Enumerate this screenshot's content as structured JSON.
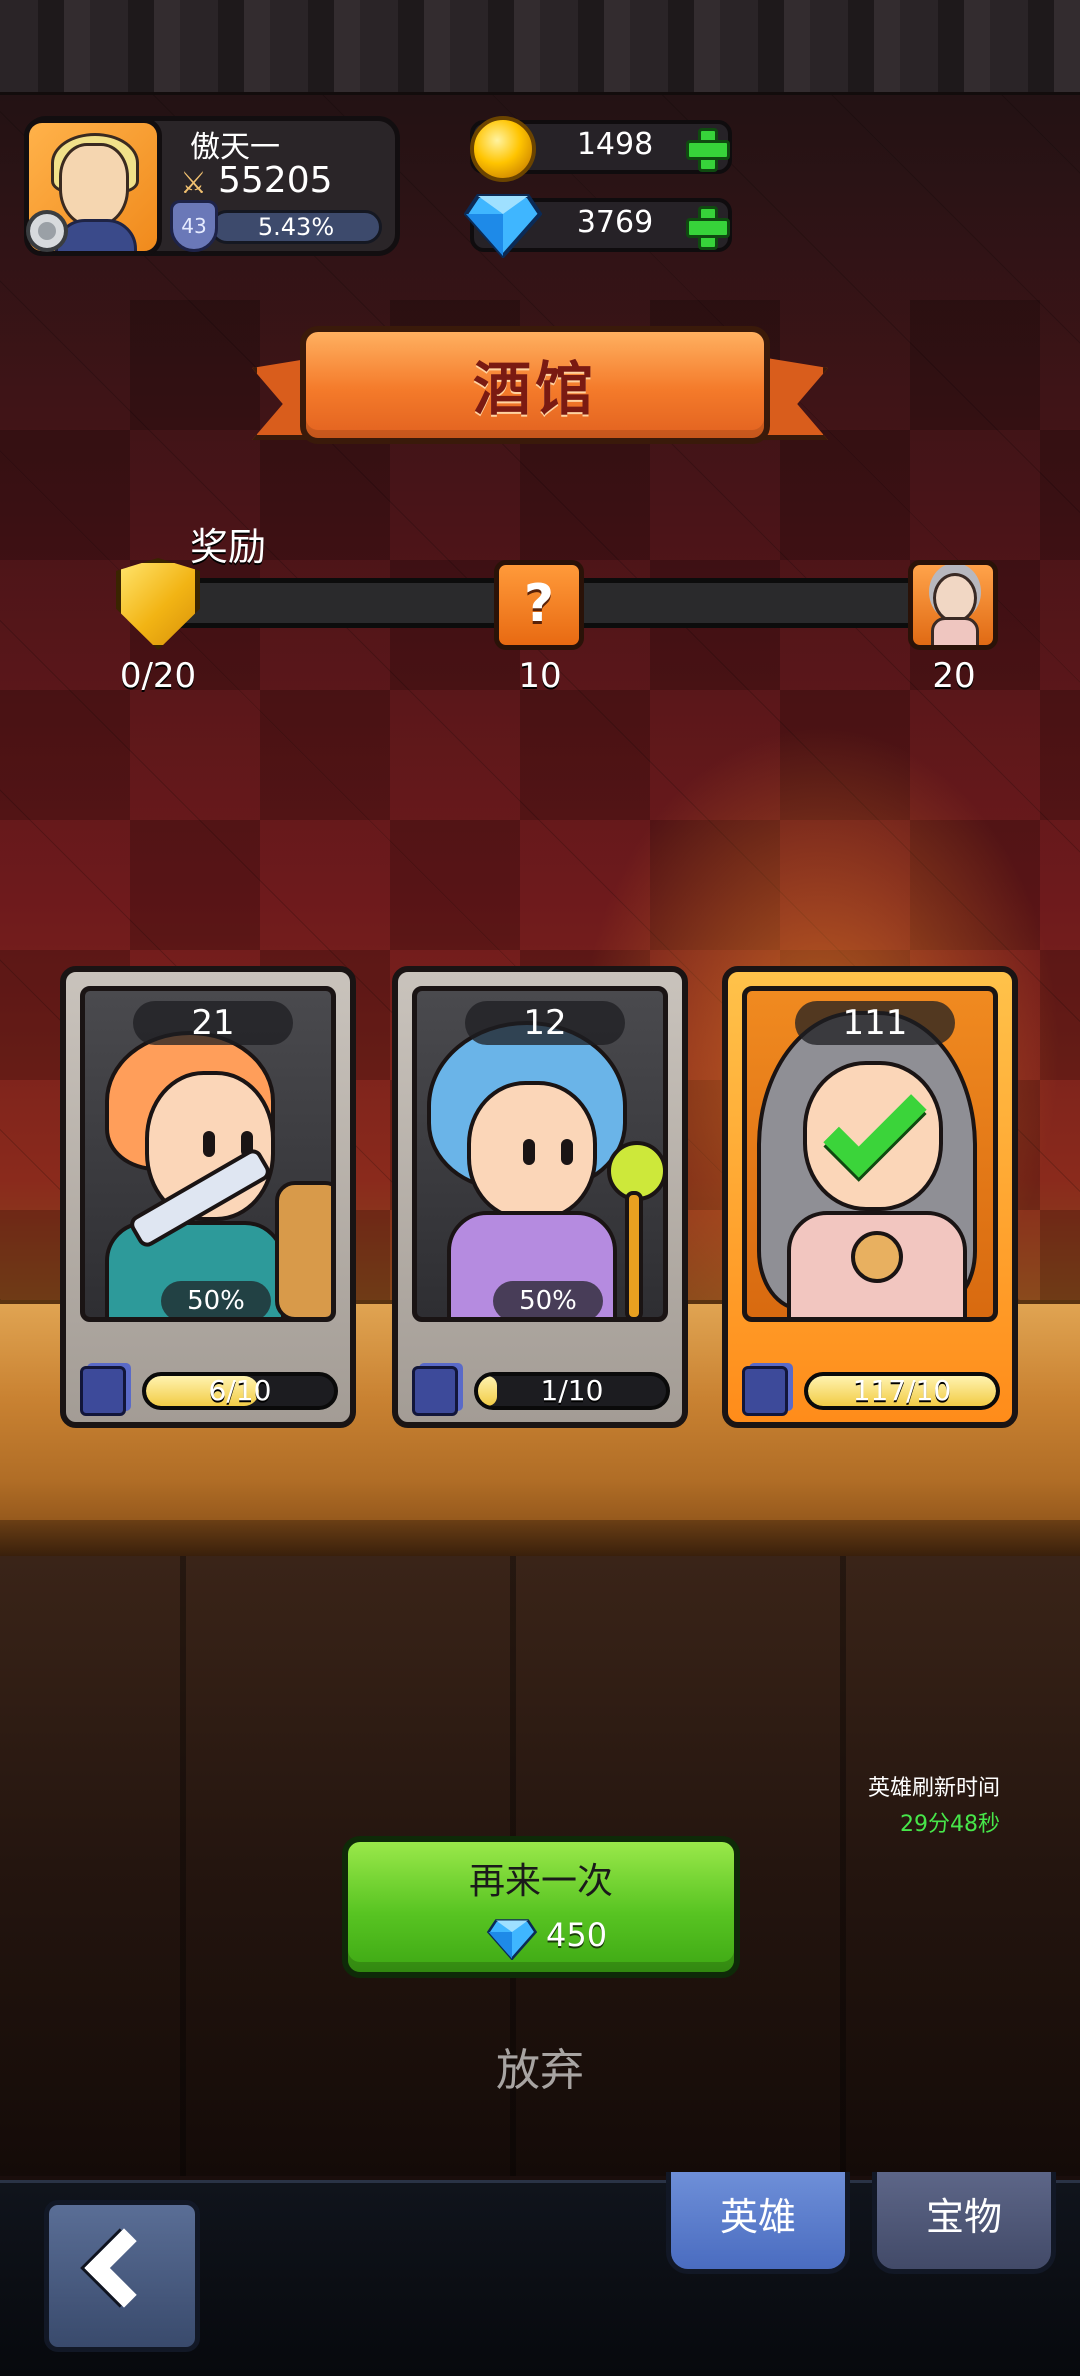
{
  "player": {
    "name": "傲天一",
    "power": "55205",
    "level": "43",
    "progress_text": "5.43%"
  },
  "currencies": {
    "gold": "1498",
    "gems": "3769"
  },
  "banner": {
    "title": "酒馆"
  },
  "rewards": {
    "label": "奖励",
    "progress": "0/20",
    "milestones": [
      "10",
      "20"
    ]
  },
  "cards": [
    {
      "level": "21",
      "percent": "50%",
      "count_text": "6/10",
      "fill": 0.6
    },
    {
      "level": "12",
      "percent": "50%",
      "count_text": "1/10",
      "fill": 0.1
    },
    {
      "level": "111",
      "count_text": "117/10",
      "fill": 1.0,
      "selected": true
    }
  ],
  "refresh": {
    "label": "英雄刷新时间",
    "time": "29分48秒"
  },
  "actions": {
    "again_label": "再来一次",
    "again_cost": "450",
    "abandon_label": "放弃"
  },
  "bottom_tabs": {
    "heroes": "英雄",
    "treasure": "宝物"
  },
  "icons": [
    "gear-icon",
    "swords-icon",
    "coin-icon",
    "gem-icon",
    "plus-icon",
    "shield-icon",
    "mystery-icon",
    "card-icon",
    "check-icon",
    "back-icon"
  ]
}
